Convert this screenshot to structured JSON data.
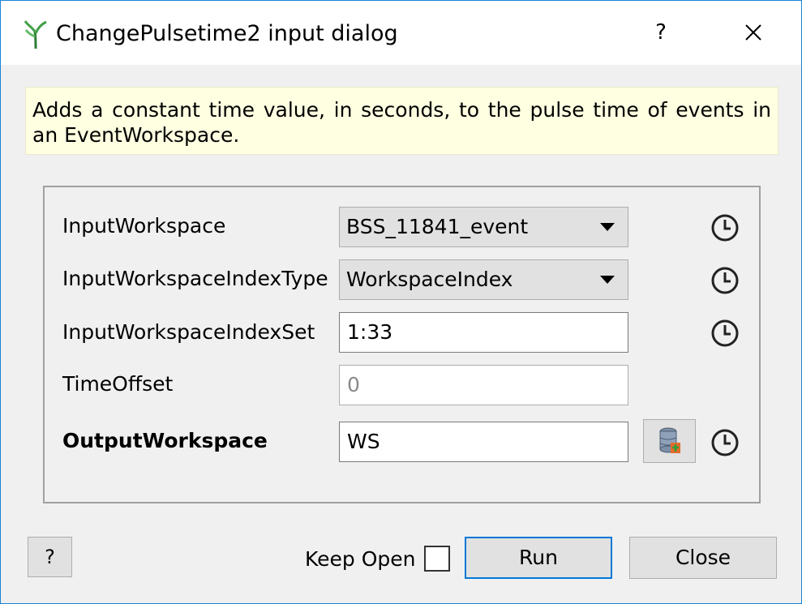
{
  "window": {
    "title": "ChangePulsetime2 input dialog",
    "help_glyph": "?",
    "close_icon": "close-icon",
    "app_icon": "mantid-plant-icon"
  },
  "description": "Adds a constant time value, in seconds, to the pulse time of events in an EventWorkspace.",
  "properties": [
    {
      "label": "InputWorkspace",
      "type": "combo",
      "value": "BSS_11841_event"
    },
    {
      "label": "InputWorkspaceIndexType",
      "type": "combo",
      "value": "WorkspaceIndex"
    },
    {
      "label": "InputWorkspaceIndexSet",
      "type": "text",
      "value": "1:33"
    },
    {
      "label": "TimeOffset",
      "type": "text",
      "placeholder": "0"
    },
    {
      "label": "OutputWorkspace",
      "type": "text",
      "value": "WS"
    }
  ],
  "footer": {
    "help_label": "?",
    "keep_open_label": "Keep Open",
    "keep_open_checked": false,
    "run_label": "Run",
    "close_label": "Close"
  },
  "colors": {
    "accent": "#0078d7",
    "description_bg": "#ffffe1",
    "window_border": "#1883d7"
  }
}
